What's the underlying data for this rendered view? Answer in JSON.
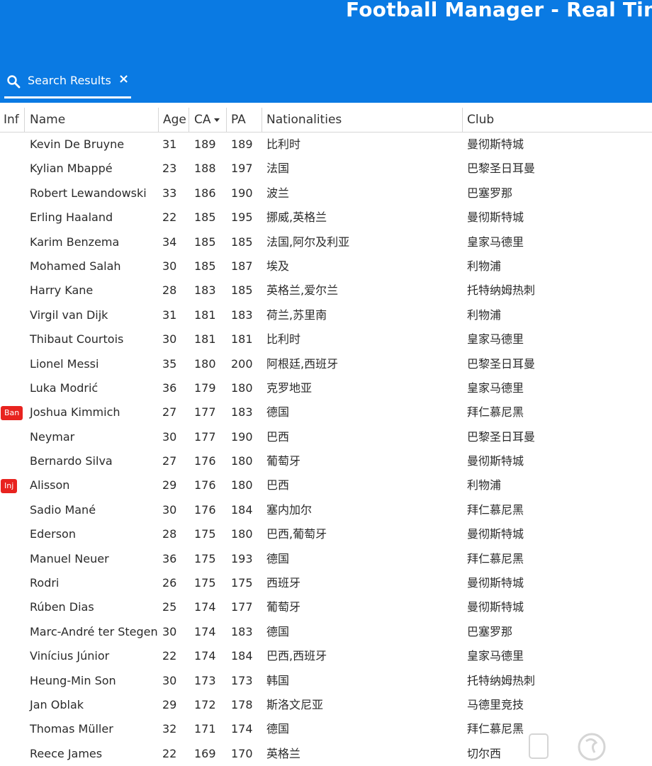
{
  "app": {
    "title": "Football Manager - Real Time Editor"
  },
  "tab": {
    "label": "Search Results",
    "close_glyph": "×",
    "icon": "search-icon"
  },
  "columns": [
    {
      "key": "inf",
      "label": "Inf"
    },
    {
      "key": "name",
      "label": "Name"
    },
    {
      "key": "age",
      "label": "Age"
    },
    {
      "key": "ca",
      "label": "CA",
      "sorted": "desc"
    },
    {
      "key": "pa",
      "label": "PA"
    },
    {
      "key": "nat",
      "label": "Nationalities"
    },
    {
      "key": "club",
      "label": "Club"
    }
  ],
  "colors": {
    "header_bg": "#0a7ae3",
    "badge_bg": "#e8231f"
  },
  "rows": [
    {
      "inf": "",
      "name": "Kevin De Bruyne",
      "age": "31",
      "ca": "189",
      "pa": "189",
      "nat": "比利时",
      "club": "曼彻斯特城"
    },
    {
      "inf": "",
      "name": "Kylian Mbappé",
      "age": "23",
      "ca": "188",
      "pa": "197",
      "nat": "法国",
      "club": "巴黎圣日耳曼"
    },
    {
      "inf": "",
      "name": "Robert Lewandowski",
      "age": "33",
      "ca": "186",
      "pa": "190",
      "nat": "波兰",
      "club": "巴塞罗那"
    },
    {
      "inf": "",
      "name": "Erling Haaland",
      "age": "22",
      "ca": "185",
      "pa": "195",
      "nat": "挪威,英格兰",
      "club": "曼彻斯特城"
    },
    {
      "inf": "",
      "name": "Karim Benzema",
      "age": "34",
      "ca": "185",
      "pa": "185",
      "nat": "法国,阿尔及利亚",
      "club": "皇家马德里"
    },
    {
      "inf": "",
      "name": "Mohamed Salah",
      "age": "30",
      "ca": "185",
      "pa": "187",
      "nat": "埃及",
      "club": "利物浦"
    },
    {
      "inf": "",
      "name": "Harry Kane",
      "age": "28",
      "ca": "183",
      "pa": "185",
      "nat": "英格兰,爱尔兰",
      "club": "托特纳姆热刺"
    },
    {
      "inf": "",
      "name": "Virgil van Dijk",
      "age": "31",
      "ca": "181",
      "pa": "183",
      "nat": "荷兰,苏里南",
      "club": "利物浦"
    },
    {
      "inf": "",
      "name": "Thibaut Courtois",
      "age": "30",
      "ca": "181",
      "pa": "181",
      "nat": "比利时",
      "club": "皇家马德里"
    },
    {
      "inf": "",
      "name": "Lionel Messi",
      "age": "35",
      "ca": "180",
      "pa": "200",
      "nat": "阿根廷,西班牙",
      "club": "巴黎圣日耳曼"
    },
    {
      "inf": "",
      "name": "Luka Modrić",
      "age": "36",
      "ca": "179",
      "pa": "180",
      "nat": "克罗地亚",
      "club": "皇家马德里"
    },
    {
      "inf": "Ban",
      "name": "Joshua Kimmich",
      "age": "27",
      "ca": "177",
      "pa": "183",
      "nat": "德国",
      "club": "拜仁慕尼黑"
    },
    {
      "inf": "",
      "name": "Neymar",
      "age": "30",
      "ca": "177",
      "pa": "190",
      "nat": "巴西",
      "club": "巴黎圣日耳曼"
    },
    {
      "inf": "",
      "name": "Bernardo Silva",
      "age": "27",
      "ca": "176",
      "pa": "180",
      "nat": "葡萄牙",
      "club": "曼彻斯特城"
    },
    {
      "inf": "Inj",
      "name": "Alisson",
      "age": "29",
      "ca": "176",
      "pa": "180",
      "nat": "巴西",
      "club": "利物浦"
    },
    {
      "inf": "",
      "name": "Sadio Mané",
      "age": "30",
      "ca": "176",
      "pa": "184",
      "nat": "塞内加尔",
      "club": "拜仁慕尼黑"
    },
    {
      "inf": "",
      "name": "Ederson",
      "age": "28",
      "ca": "175",
      "pa": "180",
      "nat": "巴西,葡萄牙",
      "club": "曼彻斯特城"
    },
    {
      "inf": "",
      "name": "Manuel Neuer",
      "age": "36",
      "ca": "175",
      "pa": "193",
      "nat": "德国",
      "club": "拜仁慕尼黑"
    },
    {
      "inf": "",
      "name": "Rodri",
      "age": "26",
      "ca": "175",
      "pa": "175",
      "nat": "西班牙",
      "club": "曼彻斯特城"
    },
    {
      "inf": "",
      "name": "Rúben Dias",
      "age": "25",
      "ca": "174",
      "pa": "177",
      "nat": "葡萄牙",
      "club": "曼彻斯特城"
    },
    {
      "inf": "",
      "name": "Marc-André ter Stegen",
      "age": "30",
      "ca": "174",
      "pa": "183",
      "nat": "德国",
      "club": "巴塞罗那"
    },
    {
      "inf": "",
      "name": "Vinícius Júnior",
      "age": "22",
      "ca": "174",
      "pa": "184",
      "nat": "巴西,西班牙",
      "club": "皇家马德里"
    },
    {
      "inf": "",
      "name": "Heung-Min Son",
      "age": "30",
      "ca": "173",
      "pa": "173",
      "nat": "韩国",
      "club": "托特纳姆热刺"
    },
    {
      "inf": "",
      "name": "Jan Oblak",
      "age": "29",
      "ca": "172",
      "pa": "178",
      "nat": "斯洛文尼亚",
      "club": "马德里竞技"
    },
    {
      "inf": "",
      "name": "Thomas Müller",
      "age": "32",
      "ca": "171",
      "pa": "174",
      "nat": "德国",
      "club": "拜仁慕尼黑"
    },
    {
      "inf": "",
      "name": "Reece James",
      "age": "22",
      "ca": "169",
      "pa": "170",
      "nat": "英格兰",
      "club": "切尔西"
    }
  ]
}
